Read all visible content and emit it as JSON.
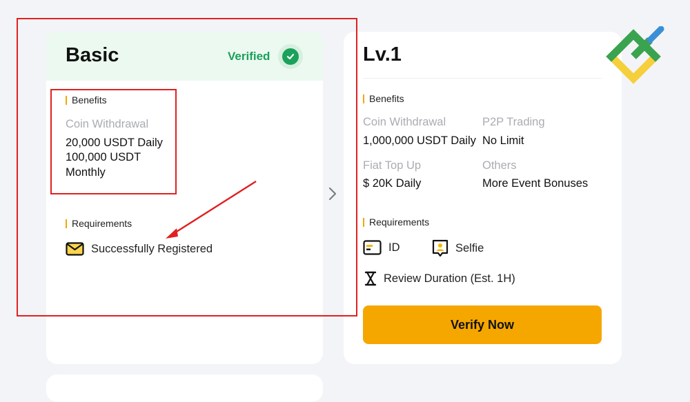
{
  "basic": {
    "title": "Basic",
    "status": "Verified",
    "benefits_label": "Benefits",
    "withdrawal_label": "Coin Withdrawal",
    "withdrawal_daily": "20,000 USDT Daily",
    "withdrawal_monthly_1": "100,000 USDT",
    "withdrawal_monthly_2": "Monthly",
    "requirements_label": "Requirements",
    "requirement": "Successfully Registered"
  },
  "lv1": {
    "title": "Lv.1",
    "benefits_label": "Benefits",
    "benefits": [
      {
        "label": "Coin Withdrawal",
        "value": "1,000,000 USDT Daily"
      },
      {
        "label": "P2P Trading",
        "value": "No Limit"
      },
      {
        "label": "Fiat Top Up",
        "value": "$ 20K Daily"
      },
      {
        "label": "Others",
        "value": "More Event Bonuses"
      }
    ],
    "requirements_label": "Requirements",
    "req_id": "ID",
    "req_selfie": "Selfie",
    "review": "Review Duration (Est. 1H)",
    "button": "Verify Now"
  },
  "colors": {
    "accent": "#f5a700",
    "verified": "#1aa15a",
    "annotation": "#e02020"
  }
}
